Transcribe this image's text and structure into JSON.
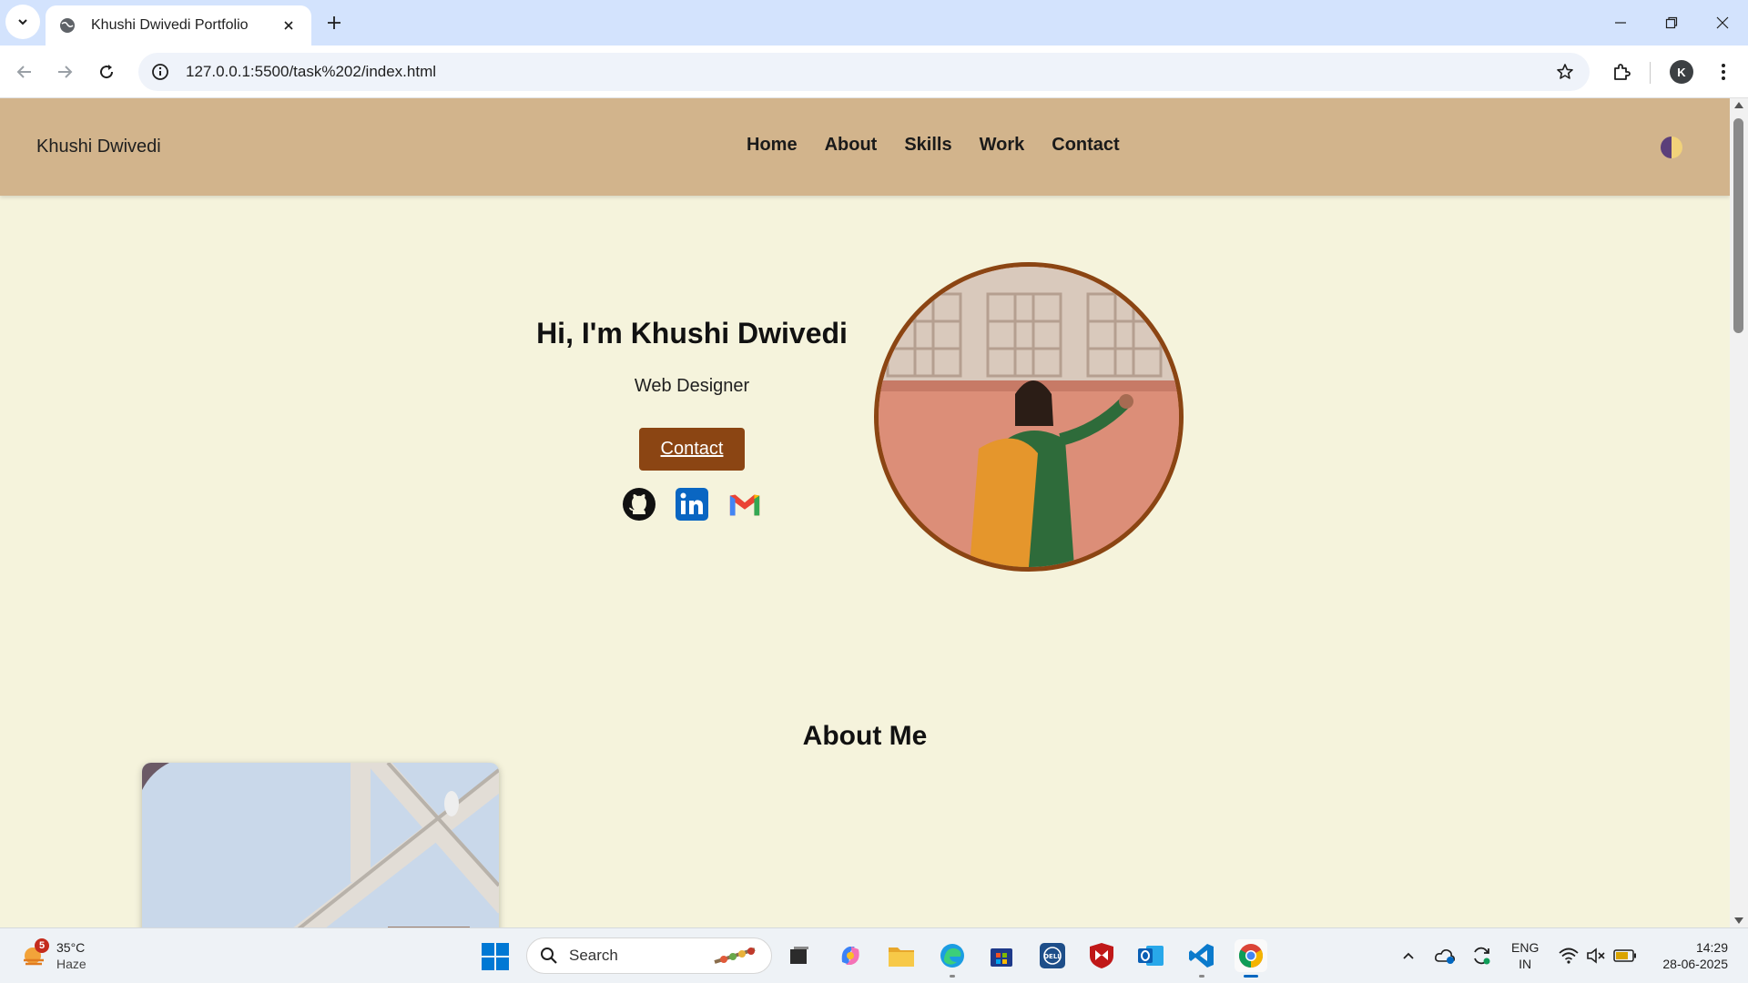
{
  "browser": {
    "tab_title": "Khushi Dwivedi Portfolio",
    "url": "127.0.0.1:5500/task%202/index.html",
    "profile_initial": "K"
  },
  "site": {
    "brand": "Khushi Dwivedi",
    "nav": [
      "Home",
      "About",
      "Skills",
      "Work",
      "Contact"
    ],
    "hero": {
      "title": "Hi, I'm Khushi Dwivedi",
      "subtitle": "Web Designer",
      "cta_label": "Contact"
    },
    "socials": [
      "github-icon",
      "linkedin-icon",
      "gmail-icon"
    ],
    "about_title": "About Me"
  },
  "colors": {
    "header_bg": "#d2b48c",
    "page_bg": "#f5f3dc",
    "accent": "#8b4513"
  },
  "taskbar": {
    "weather_badge": "5",
    "temperature": "35°C",
    "condition": "Haze",
    "search_label": "Search",
    "lang_line1": "ENG",
    "lang_line2": "IN",
    "time": "14:29",
    "date": "28-06-2025"
  }
}
